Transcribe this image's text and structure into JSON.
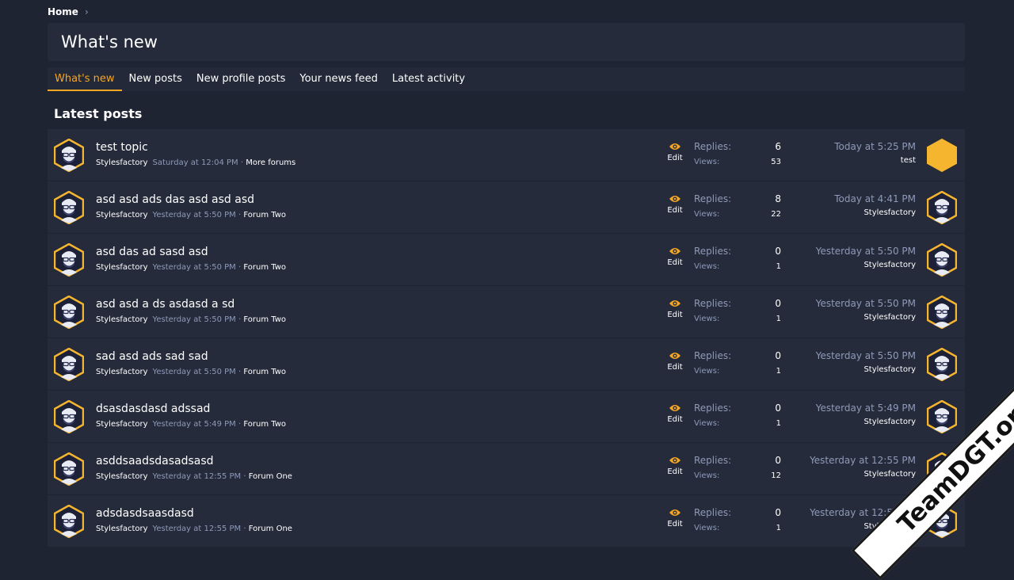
{
  "breadcrumb": {
    "home": "Home",
    "separator": "›"
  },
  "page": {
    "title": "What's new"
  },
  "tabs": [
    {
      "label": "What's new",
      "active": true
    },
    {
      "label": "New posts",
      "active": false
    },
    {
      "label": "New profile posts",
      "active": false
    },
    {
      "label": "Your news feed",
      "active": false
    },
    {
      "label": "Latest activity",
      "active": false
    }
  ],
  "section": {
    "title": "Latest posts"
  },
  "labels": {
    "replies": "Replies:",
    "views": "Views:",
    "edit": "Edit",
    "separator": "·"
  },
  "posts": [
    {
      "title": "test topic",
      "author": "Stylesfactory",
      "date": "Saturday at 12:04 PM",
      "forum": "More forums",
      "replies": "6",
      "views": "53",
      "last_date": "Today at 5:25 PM",
      "last_user": "test",
      "last_avatar": "default-hexagon"
    },
    {
      "title": "asd asd ads das asd asd asd",
      "author": "Stylesfactory",
      "date": "Yesterday at 5:50 PM",
      "forum": "Forum Two",
      "replies": "8",
      "views": "22",
      "last_date": "Today at 4:41 PM",
      "last_user": "Stylesfactory",
      "last_avatar": "user"
    },
    {
      "title": "asd das ad sasd asd",
      "author": "Stylesfactory",
      "date": "Yesterday at 5:50 PM",
      "forum": "Forum Two",
      "replies": "0",
      "views": "1",
      "last_date": "Yesterday at 5:50 PM",
      "last_user": "Stylesfactory",
      "last_avatar": "user"
    },
    {
      "title": "asd asd a ds asdasd a sd",
      "author": "Stylesfactory",
      "date": "Yesterday at 5:50 PM",
      "forum": "Forum Two",
      "replies": "0",
      "views": "1",
      "last_date": "Yesterday at 5:50 PM",
      "last_user": "Stylesfactory",
      "last_avatar": "user"
    },
    {
      "title": "sad asd ads sad sad",
      "author": "Stylesfactory",
      "date": "Yesterday at 5:50 PM",
      "forum": "Forum Two",
      "replies": "0",
      "views": "1",
      "last_date": "Yesterday at 5:50 PM",
      "last_user": "Stylesfactory",
      "last_avatar": "user"
    },
    {
      "title": "dsasdasdasd adssad",
      "author": "Stylesfactory",
      "date": "Yesterday at 5:49 PM",
      "forum": "Forum Two",
      "replies": "0",
      "views": "1",
      "last_date": "Yesterday at 5:49 PM",
      "last_user": "Stylesfactory",
      "last_avatar": "user"
    },
    {
      "title": "asddsaadsdasadsasd",
      "author": "Stylesfactory",
      "date": "Yesterday at 12:55 PM",
      "forum": "Forum One",
      "replies": "0",
      "views": "12",
      "last_date": "Yesterday at 12:55 PM",
      "last_user": "Stylesfactory",
      "last_avatar": "user"
    },
    {
      "title": "adsdasdsaasdasd",
      "author": "Stylesfactory",
      "date": "Yesterday at 12:55 PM",
      "forum": "Forum One",
      "replies": "0",
      "views": "1",
      "last_date": "Yesterday at 12:55 PM",
      "last_user": "Stylesfactory",
      "last_avatar": "user"
    }
  ],
  "watermark": {
    "text": "TeamDGT.org"
  },
  "colors": {
    "accent": "#f5a623",
    "background": "#1f2433",
    "panel": "#252b3b",
    "muted": "#8e9ab8"
  }
}
